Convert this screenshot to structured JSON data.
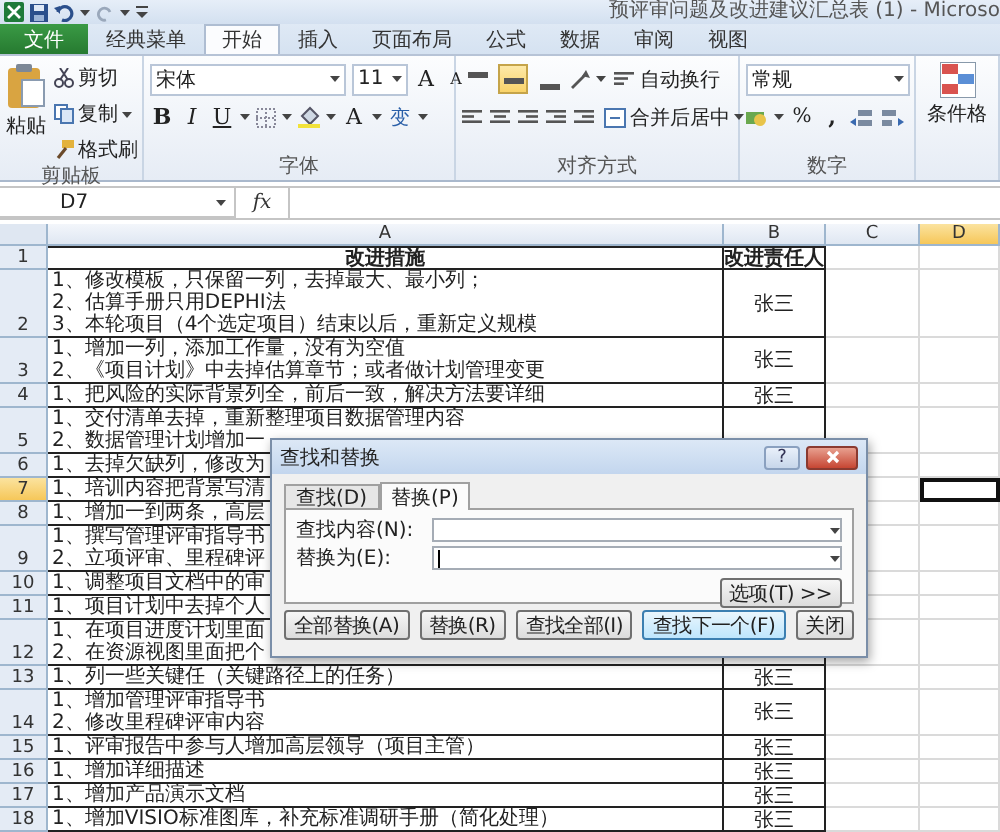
{
  "window": {
    "title": "预评审问题及改进建议汇总表 (1) - Microso"
  },
  "ribbon_tabs": [
    {
      "label": "文件",
      "kind": "file",
      "selected": false
    },
    {
      "label": "经典菜单",
      "kind": "tab",
      "selected": false
    },
    {
      "label": "开始",
      "kind": "tab",
      "selected": true
    },
    {
      "label": "插入",
      "kind": "tab",
      "selected": false
    },
    {
      "label": "页面布局",
      "kind": "tab",
      "selected": false
    },
    {
      "label": "公式",
      "kind": "tab",
      "selected": false
    },
    {
      "label": "数据",
      "kind": "tab",
      "selected": false
    },
    {
      "label": "审阅",
      "kind": "tab",
      "selected": false
    },
    {
      "label": "视图",
      "kind": "tab",
      "selected": false
    }
  ],
  "ribbon": {
    "clipboard": {
      "label": "剪贴板",
      "paste": "粘贴",
      "cut": "剪切",
      "copy": "复制",
      "format_painter": "格式刷"
    },
    "font": {
      "label": "字体",
      "name": "宋体",
      "size": "11",
      "grow": "A",
      "shrink": "A",
      "bold": "B",
      "italic": "I",
      "underline": "U",
      "font_color_label": "A",
      "phonetic": "变"
    },
    "alignment": {
      "label": "对齐方式",
      "vertical": [
        {
          "selected": false
        },
        {
          "selected": true
        },
        {
          "selected": false
        }
      ],
      "wrap_text": "自动换行",
      "merge_center": "合并后居中"
    },
    "number": {
      "label": "数字",
      "format": "常规",
      "percent": "%",
      "comma": ","
    },
    "styles": {
      "conditional_format": "条件格"
    }
  },
  "formula_bar": {
    "name_box": "D7",
    "function_label": "fx"
  },
  "sheet": {
    "columns": [
      {
        "label": "A",
        "selected": false
      },
      {
        "label": "B",
        "selected": false
      },
      {
        "label": "C",
        "selected": false
      },
      {
        "label": "D",
        "selected": true
      }
    ],
    "rows": [
      {
        "number": "1",
        "kind": "header",
        "selected": false,
        "a": [
          "改进措施"
        ],
        "b": "改进责任人"
      },
      {
        "number": "2",
        "kind": "data",
        "selected": false,
        "a": [
          "1、修改模板，只保留一列，去掉最大、最小列；",
          "2、估算手册只用DEPHI法",
          "3、本轮项目（4个选定项目）结束以后，重新定义规模"
        ],
        "b": "张三"
      },
      {
        "number": "3",
        "kind": "data",
        "selected": false,
        "a": [
          "1、增加一列，添加工作量，没有为空值",
          "2、《项目计划》中去掉估算章节；或者做计划管理变更"
        ],
        "b": "张三"
      },
      {
        "number": "4",
        "kind": "data",
        "selected": false,
        "a": [
          "1、把风险的实际背景列全，前后一致，解决方法要详细"
        ],
        "b": "张三"
      },
      {
        "number": "5",
        "kind": "data",
        "selected": false,
        "a": [
          "1、交付清单去掉，重新整理项目数据管理内容",
          "2、数据管理计划增加一"
        ]
      },
      {
        "number": "6",
        "kind": "data",
        "selected": false,
        "a": [
          "1、去掉欠缺列，修改为"
        ]
      },
      {
        "number": "7",
        "kind": "data",
        "selected": true,
        "a": [
          "1、培训内容把背景写清"
        ]
      },
      {
        "number": "8",
        "kind": "data",
        "selected": false,
        "a": [
          "1、增加一到两条，高层"
        ]
      },
      {
        "number": "9",
        "kind": "data",
        "selected": false,
        "a": [
          "1、撰写管理评审指导书",
          "2、立项评审、里程碑评"
        ]
      },
      {
        "number": "10",
        "kind": "data",
        "selected": false,
        "a": [
          "1、调整项目文档中的审"
        ]
      },
      {
        "number": "11",
        "kind": "data",
        "selected": false,
        "a": [
          "1、项目计划中去掉个人"
        ]
      },
      {
        "number": "12",
        "kind": "data",
        "selected": false,
        "a": [
          "1、在项目进度计划里面",
          "2、在资源视图里面把个"
        ]
      },
      {
        "number": "13",
        "kind": "data",
        "selected": false,
        "a": [
          "1、列一些关键任（关键路径上的任务）"
        ],
        "b": "张三"
      },
      {
        "number": "14",
        "kind": "data",
        "selected": false,
        "a": [
          "1、增加管理评审指导书",
          "2、修改里程碑评审内容"
        ],
        "b": "张三"
      },
      {
        "number": "15",
        "kind": "data",
        "selected": false,
        "a": [
          "1、评审报告中参与人增加高层领导（项目主管）"
        ],
        "b": "张三"
      },
      {
        "number": "16",
        "kind": "data",
        "selected": false,
        "a": [
          "1、增加详细描述"
        ],
        "b": "张三"
      },
      {
        "number": "17",
        "kind": "data",
        "selected": false,
        "a": [
          "1、增加产品演示文档"
        ],
        "b": "张三"
      },
      {
        "number": "18",
        "kind": "data",
        "selected": false,
        "a": [
          "1、增加VISIO标准图库，补充标准调研手册（简化处理）"
        ],
        "b": "张三"
      }
    ]
  },
  "dialog": {
    "title": "查找和替换",
    "help": "?",
    "tabs": [
      {
        "label": "查找(D)",
        "selected": false
      },
      {
        "label": "替换(P)",
        "selected": true
      }
    ],
    "find_label": "查找内容(N):",
    "replace_label": "替换为(E):",
    "options_button": "选项(T) >>",
    "buttons": [
      {
        "label": "全部替换(A)",
        "default": false
      },
      {
        "label": "替换(R)",
        "default": false
      },
      {
        "label": "查找全部(I)",
        "default": false
      },
      {
        "label": "查找下一个(F)",
        "default": true
      },
      {
        "label": "关闭",
        "default": false
      }
    ]
  }
}
